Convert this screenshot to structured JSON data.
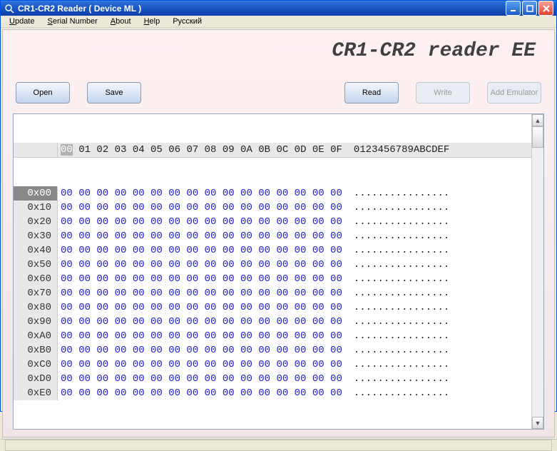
{
  "window": {
    "title": "CR1-CR2 Reader ( Device ML )"
  },
  "menu": {
    "items": [
      "Update",
      "Serial Number",
      "About",
      "Help",
      "Русский"
    ]
  },
  "header": {
    "title": "CR1-CR2 reader EE"
  },
  "toolbar": {
    "open": "Open",
    "save": "Save",
    "read": "Read",
    "write": "Write",
    "add_emulator": "Add Emulator"
  },
  "hex": {
    "col_header_first": "00",
    "col_header_rest": " 01 02 03 04 05 06 07 08 09 0A 0B 0C 0D 0E 0F",
    "ascii_header": "0123456789ABCDEF",
    "rows": [
      {
        "addr": "0x00",
        "bytes": "00 00 00 00 00 00 00 00 00 00 00 00 00 00 00 00",
        "ascii": "................"
      },
      {
        "addr": "0x10",
        "bytes": "00 00 00 00 00 00 00 00 00 00 00 00 00 00 00 00",
        "ascii": "................"
      },
      {
        "addr": "0x20",
        "bytes": "00 00 00 00 00 00 00 00 00 00 00 00 00 00 00 00",
        "ascii": "................"
      },
      {
        "addr": "0x30",
        "bytes": "00 00 00 00 00 00 00 00 00 00 00 00 00 00 00 00",
        "ascii": "................"
      },
      {
        "addr": "0x40",
        "bytes": "00 00 00 00 00 00 00 00 00 00 00 00 00 00 00 00",
        "ascii": "................"
      },
      {
        "addr": "0x50",
        "bytes": "00 00 00 00 00 00 00 00 00 00 00 00 00 00 00 00",
        "ascii": "................"
      },
      {
        "addr": "0x60",
        "bytes": "00 00 00 00 00 00 00 00 00 00 00 00 00 00 00 00",
        "ascii": "................"
      },
      {
        "addr": "0x70",
        "bytes": "00 00 00 00 00 00 00 00 00 00 00 00 00 00 00 00",
        "ascii": "................"
      },
      {
        "addr": "0x80",
        "bytes": "00 00 00 00 00 00 00 00 00 00 00 00 00 00 00 00",
        "ascii": "................"
      },
      {
        "addr": "0x90",
        "bytes": "00 00 00 00 00 00 00 00 00 00 00 00 00 00 00 00",
        "ascii": "................"
      },
      {
        "addr": "0xA0",
        "bytes": "00 00 00 00 00 00 00 00 00 00 00 00 00 00 00 00",
        "ascii": "................"
      },
      {
        "addr": "0xB0",
        "bytes": "00 00 00 00 00 00 00 00 00 00 00 00 00 00 00 00",
        "ascii": "................"
      },
      {
        "addr": "0xC0",
        "bytes": "00 00 00 00 00 00 00 00 00 00 00 00 00 00 00 00",
        "ascii": "................"
      },
      {
        "addr": "0xD0",
        "bytes": "00 00 00 00 00 00 00 00 00 00 00 00 00 00 00 00",
        "ascii": "................"
      },
      {
        "addr": "0xE0",
        "bytes": "00 00 00 00 00 00 00 00 00 00 00 00 00 00 00 00",
        "ascii": "................"
      }
    ]
  },
  "status": {
    "text": ""
  }
}
